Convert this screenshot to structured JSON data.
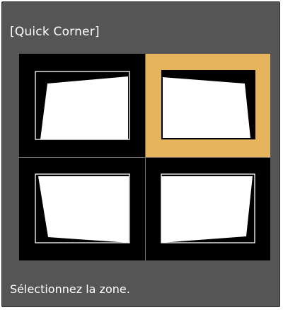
{
  "dialog": {
    "title": "[Quick Corner]",
    "status_text": "Sélectionnez la zone.",
    "selected_zone": "top-right",
    "accent_color": "#e6b45c"
  },
  "zones": [
    {
      "id": "top-left",
      "selected": false
    },
    {
      "id": "top-right",
      "selected": true
    },
    {
      "id": "bottom-left",
      "selected": false
    },
    {
      "id": "bottom-right",
      "selected": false
    }
  ]
}
